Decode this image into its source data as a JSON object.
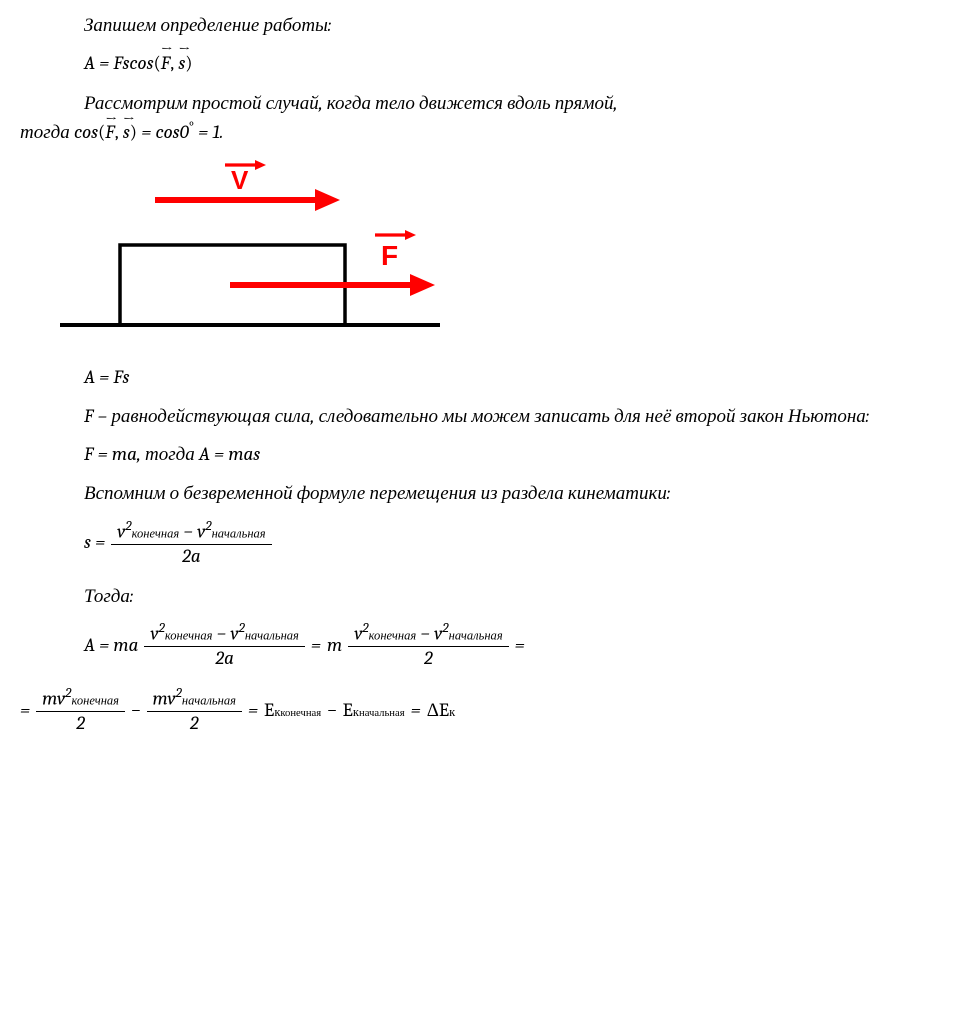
{
  "p1": "Запишем определение работы:",
  "eq1_plain": "A = F s cos(F, s)",
  "eq1": {
    "lhs": "A = Fs",
    "cos": "cos",
    "lparen": "(",
    "F": "F",
    "comma": ",",
    "s": "s",
    "rparen": ")"
  },
  "p2a": "Рассмотрим простой случай, когда тело движется вдоль прямой,",
  "p2b_pre": "тогда ",
  "p2b_cos": "cos",
  "p2b_lp": "(",
  "p2b_F": "F",
  "p2b_comma": ",",
  "p2b_s": "s",
  "p2b_rp": ")",
  "p2b_eq": " = ",
  "p2b_cos0": "cos",
  "p2b_zero": "0",
  "p2b_deg": "°",
  "p2b_eq2": " = 1.",
  "diagram_labels": {
    "V": "V",
    "F": "F"
  },
  "eq2": "A = Fs",
  "p3": "F – равнодействующая сила, следовательно мы можем записать для неё второй закон Ньютона:",
  "eq3": "F = ma, тогда  A = mas",
  "p4": "Вспомним о безвременной формуле перемещения из раздела кинематики:",
  "eq4": {
    "s_eq": "s = ",
    "num_l": "v",
    "num_l_exp": "2",
    "num_l_sub": "конечная",
    "minus": " − ",
    "num_r": "v",
    "num_r_exp": "2",
    "num_r_sub": "начальная",
    "den": "2a"
  },
  "p5": "Тогда:",
  "eq5": {
    "A_eq_ma": "A = ma ",
    "eq": " = ",
    "m": " m ",
    "den2a": "2a",
    "den2": "2",
    "tail_eq": " ="
  },
  "eq6": {
    "lead_eq": "= ",
    "mv": "mv",
    "exp2": "2",
    "sub_fin": "конечная",
    "sub_ini": "начальная",
    "den2": "2",
    "minus": " − ",
    "eq": " = ",
    "E": "E",
    "Esub_k": "к",
    "dE": "ΔE",
    "dEsub": "к"
  }
}
